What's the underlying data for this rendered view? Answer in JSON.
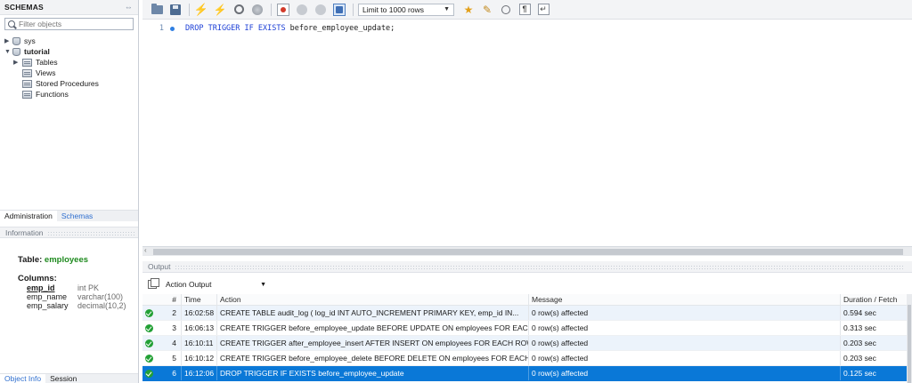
{
  "sidebar": {
    "header": "SCHEMAS",
    "header_control": "⇔",
    "filter_placeholder": "Filter objects",
    "schemas": [
      {
        "name": "sys",
        "expanded": false
      },
      {
        "name": "tutorial",
        "expanded": true,
        "children": [
          "Tables",
          "Views",
          "Stored Procedures",
          "Functions"
        ]
      }
    ],
    "tabs": [
      "Administration",
      "Schemas"
    ],
    "info_header": "Information",
    "info": {
      "table_label": "Table:",
      "table_name": "employees",
      "columns_label": "Columns:",
      "columns": [
        {
          "name": "emp_id",
          "type": "int PK"
        },
        {
          "name": "emp_name",
          "type": "varchar(100)"
        },
        {
          "name": "emp_salary",
          "type": "decimal(10,2)"
        }
      ]
    },
    "bottom_tabs": [
      "Object Info",
      "Session"
    ]
  },
  "toolbar": {
    "limit_label": "Limit to 1000 rows"
  },
  "editor": {
    "line_number": "1",
    "code_keywords": "DROP TRIGGER IF EXISTS",
    "code_identifier": "before_employee_update;"
  },
  "output": {
    "header": "Output",
    "selector": "Action Output",
    "columns": [
      "#",
      "Time",
      "Action",
      "Message",
      "Duration / Fetch"
    ],
    "rows": [
      {
        "num": "2",
        "time": "16:02:58",
        "action": "CREATE TABLE audit_log (     log_id INT AUTO_INCREMENT PRIMARY KEY,     emp_id IN...",
        "message": "0 row(s) affected",
        "duration": "0.594 sec"
      },
      {
        "num": "3",
        "time": "16:06:13",
        "action": "CREATE TRIGGER before_employee_update BEFORE UPDATE ON employees FOR EACH ...",
        "message": "0 row(s) affected",
        "duration": "0.313 sec"
      },
      {
        "num": "4",
        "time": "16:10:11",
        "action": "CREATE TRIGGER after_employee_insert AFTER INSERT ON employees FOR EACH ROW...",
        "message": "0 row(s) affected",
        "duration": "0.203 sec"
      },
      {
        "num": "5",
        "time": "16:10:12",
        "action": "CREATE TRIGGER before_employee_delete BEFORE DELETE ON employees FOR EACH ...",
        "message": "0 row(s) affected",
        "duration": "0.203 sec"
      },
      {
        "num": "6",
        "time": "16:12:06",
        "action": "DROP TRIGGER IF EXISTS before_employee_update",
        "message": "0 row(s) affected",
        "duration": "0.125 sec"
      }
    ]
  }
}
